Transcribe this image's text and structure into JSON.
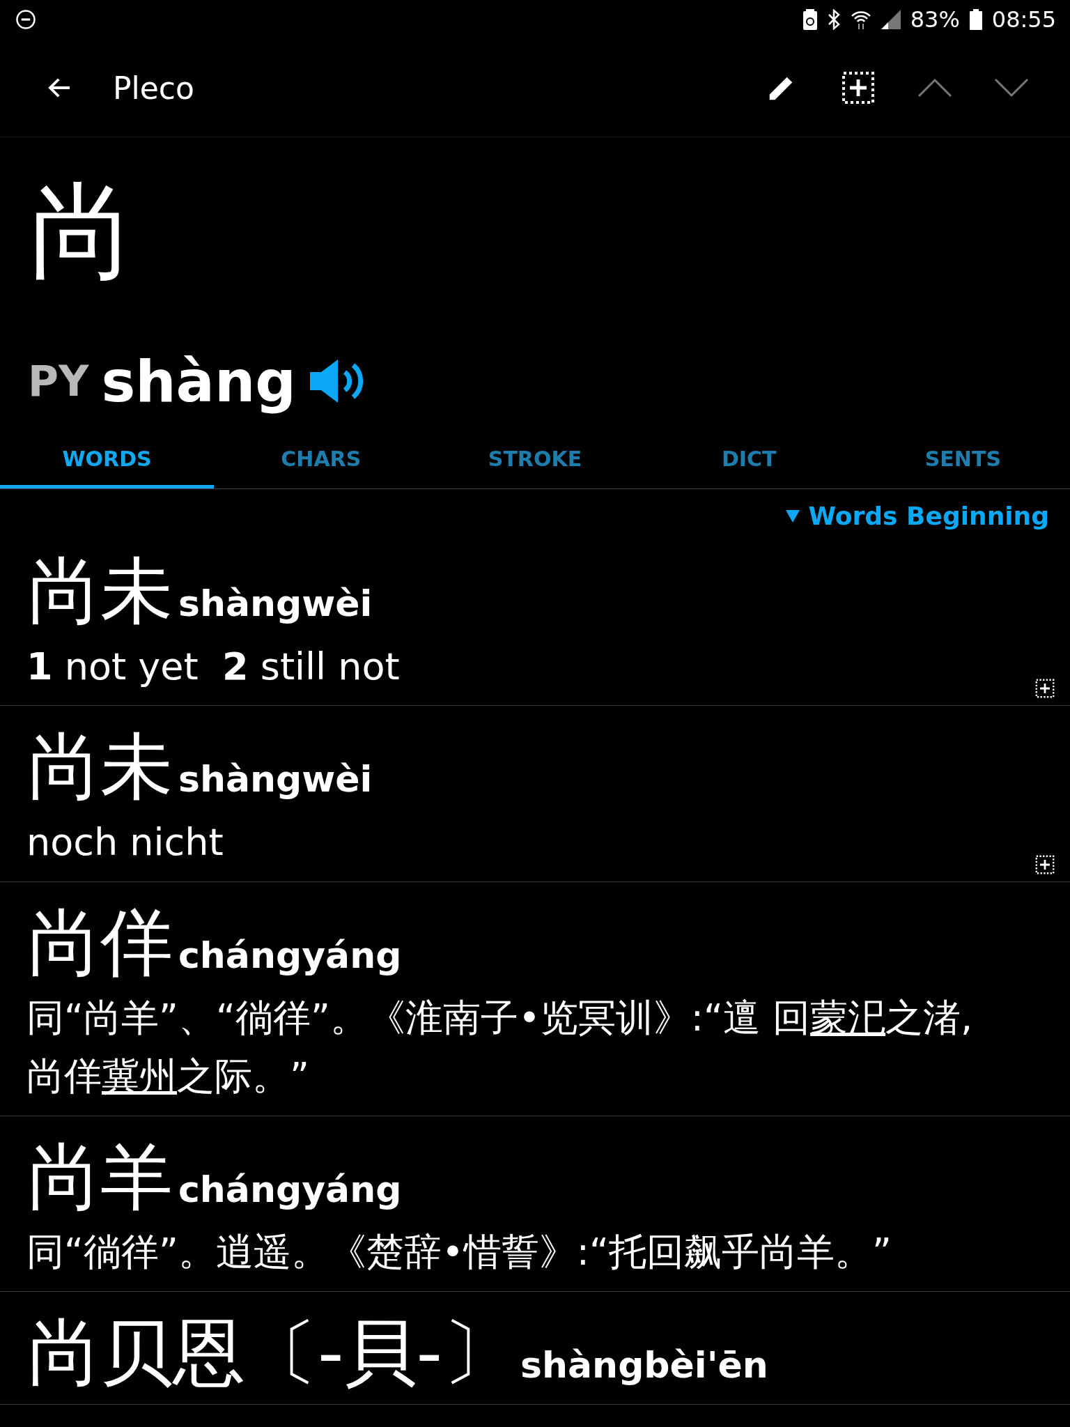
{
  "status_bar": {
    "battery": "83%",
    "time": "08:55"
  },
  "toolbar": {
    "title": "Pleco"
  },
  "headword": {
    "character": "尚",
    "system": "PY",
    "pinyin": "shàng"
  },
  "tabs": [
    {
      "label": "WORDS",
      "selected": true
    },
    {
      "label": "CHARS",
      "selected": false
    },
    {
      "label": "STROKE",
      "selected": false
    },
    {
      "label": "DICT",
      "selected": false
    },
    {
      "label": "SENTS",
      "selected": false
    }
  ],
  "filter": {
    "label": "Words Beginning"
  },
  "entries": [
    {
      "hanzi": "尚未",
      "pinyin": "shàngwèi",
      "definition": [
        {
          "text": "**1** not yet  **2** still not",
          "link": false
        }
      ],
      "flashcard_button": true
    },
    {
      "hanzi": "尚未",
      "pinyin": "shàngwèi",
      "definition": [
        {
          "text": "noch nicht",
          "link": false
        }
      ],
      "flashcard_button": true
    },
    {
      "hanzi": "尚佯",
      "pinyin": "chángyáng",
      "definition": [
        {
          "text": "同“尚羊”、“徜徉”。《淮南子•览冥训》:“邅 回",
          "link": false
        },
        {
          "text": "蒙汜",
          "link": true
        },
        {
          "text": "之渚,尚佯",
          "link": false
        },
        {
          "text": "冀州",
          "link": true
        },
        {
          "text": "之际。”",
          "link": false
        }
      ],
      "flashcard_button": false
    },
    {
      "hanzi": "尚羊",
      "pinyin": "chángyáng",
      "definition": [
        {
          "text": "同“徜徉”。逍遥。《楚辞•惜誓》:“托回飙乎尚羊。”",
          "link": false
        }
      ],
      "flashcard_button": false
    },
    {
      "hanzi": "尚贝恩〔-貝-〕",
      "pinyin": "shàngbèi'ēn"
    }
  ]
}
